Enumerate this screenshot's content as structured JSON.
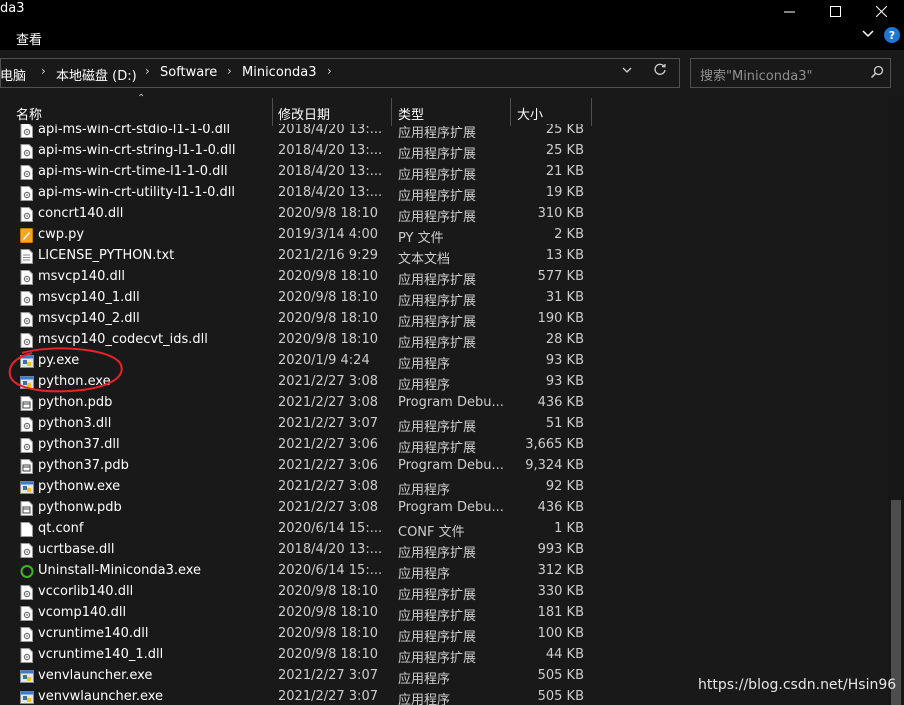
{
  "window": {
    "title": "da3",
    "minimize": "—",
    "maximize": "☐",
    "close": "✕"
  },
  "ribbon": {
    "tab_view": "查看",
    "expand": "⌄",
    "help": "?"
  },
  "address": {
    "crumbs": [
      "电脑",
      "本地磁盘 (D:)",
      "Software",
      "Miniconda3"
    ],
    "separator": "›"
  },
  "search": {
    "placeholder": "搜索\"Miniconda3\""
  },
  "columns": {
    "name": "名称",
    "date": "修改日期",
    "type": "类型",
    "size": "大小"
  },
  "files": [
    {
      "name": "api-ms-win-crt-stdio-l1-1-0.dll",
      "date": "2018/4/20 13:...",
      "type": "应用程序扩展",
      "size": "25 KB",
      "icon": "dll-icon"
    },
    {
      "name": "api-ms-win-crt-string-l1-1-0.dll",
      "date": "2018/4/20 13:...",
      "type": "应用程序扩展",
      "size": "25 KB",
      "icon": "dll-icon"
    },
    {
      "name": "api-ms-win-crt-time-l1-1-0.dll",
      "date": "2018/4/20 13:...",
      "type": "应用程序扩展",
      "size": "21 KB",
      "icon": "dll-icon"
    },
    {
      "name": "api-ms-win-crt-utility-l1-1-0.dll",
      "date": "2018/4/20 13:...",
      "type": "应用程序扩展",
      "size": "19 KB",
      "icon": "dll-icon"
    },
    {
      "name": "concrt140.dll",
      "date": "2020/9/8 18:10",
      "type": "应用程序扩展",
      "size": "310 KB",
      "icon": "dll-icon"
    },
    {
      "name": "cwp.py",
      "date": "2019/3/14 4:00",
      "type": "PY 文件",
      "size": "2 KB",
      "icon": "py-file-icon"
    },
    {
      "name": "LICENSE_PYTHON.txt",
      "date": "2021/2/16 9:29",
      "type": "文本文档",
      "size": "13 KB",
      "icon": "text-file-icon"
    },
    {
      "name": "msvcp140.dll",
      "date": "2020/9/8 18:10",
      "type": "应用程序扩展",
      "size": "577 KB",
      "icon": "dll-icon"
    },
    {
      "name": "msvcp140_1.dll",
      "date": "2020/9/8 18:10",
      "type": "应用程序扩展",
      "size": "31 KB",
      "icon": "dll-icon"
    },
    {
      "name": "msvcp140_2.dll",
      "date": "2020/9/8 18:10",
      "type": "应用程序扩展",
      "size": "190 KB",
      "icon": "dll-icon"
    },
    {
      "name": "msvcp140_codecvt_ids.dll",
      "date": "2020/9/8 18:10",
      "type": "应用程序扩展",
      "size": "28 KB",
      "icon": "dll-icon"
    },
    {
      "name": "py.exe",
      "date": "2020/1/9 4:24",
      "type": "应用程序",
      "size": "93 KB",
      "icon": "python-exe-icon"
    },
    {
      "name": "python.exe",
      "date": "2021/2/27 3:08",
      "type": "应用程序",
      "size": "93 KB",
      "icon": "python-exe-icon"
    },
    {
      "name": "python.pdb",
      "date": "2021/2/27 3:08",
      "type": "Program Debu...",
      "size": "436 KB",
      "icon": "pdb-icon"
    },
    {
      "name": "python3.dll",
      "date": "2021/2/27 3:07",
      "type": "应用程序扩展",
      "size": "51 KB",
      "icon": "dll-icon"
    },
    {
      "name": "python37.dll",
      "date": "2021/2/27 3:06",
      "type": "应用程序扩展",
      "size": "3,665 KB",
      "icon": "dll-icon"
    },
    {
      "name": "python37.pdb",
      "date": "2021/2/27 3:06",
      "type": "Program Debu...",
      "size": "9,324 KB",
      "icon": "pdb-icon"
    },
    {
      "name": "pythonw.exe",
      "date": "2021/2/27 3:08",
      "type": "应用程序",
      "size": "92 KB",
      "icon": "python-exe-icon"
    },
    {
      "name": "pythonw.pdb",
      "date": "2021/2/27 3:08",
      "type": "Program Debu...",
      "size": "436 KB",
      "icon": "pdb-icon"
    },
    {
      "name": "qt.conf",
      "date": "2020/6/14 15:...",
      "type": "CONF 文件",
      "size": "1 KB",
      "icon": "blank-file-icon"
    },
    {
      "name": "ucrtbase.dll",
      "date": "2018/4/20 13:...",
      "type": "应用程序扩展",
      "size": "993 KB",
      "icon": "dll-icon"
    },
    {
      "name": "Uninstall-Miniconda3.exe",
      "date": "2020/6/14 15:...",
      "type": "应用程序",
      "size": "312 KB",
      "icon": "uninstall-icon"
    },
    {
      "name": "vccorlib140.dll",
      "date": "2020/9/8 18:10",
      "type": "应用程序扩展",
      "size": "330 KB",
      "icon": "dll-icon"
    },
    {
      "name": "vcomp140.dll",
      "date": "2020/9/8 18:10",
      "type": "应用程序扩展",
      "size": "181 KB",
      "icon": "dll-icon"
    },
    {
      "name": "vcruntime140.dll",
      "date": "2020/9/8 18:10",
      "type": "应用程序扩展",
      "size": "100 KB",
      "icon": "dll-icon"
    },
    {
      "name": "vcruntime140_1.dll",
      "date": "2020/9/8 18:10",
      "type": "应用程序扩展",
      "size": "44 KB",
      "icon": "dll-icon"
    },
    {
      "name": "venvlauncher.exe",
      "date": "2021/2/27 3:07",
      "type": "应用程序",
      "size": "505 KB",
      "icon": "python-exe-icon"
    },
    {
      "name": "venvwlauncher.exe",
      "date": "2021/2/27 3:07",
      "type": "应用程序",
      "size": "505 KB",
      "icon": "python-exe-icon"
    }
  ],
  "watermark": "https://blog.csdn.net/Hsin96",
  "colors": {
    "annotation": "#e8232a",
    "background": "#191919",
    "scroll_thumb": "#4d4d4d"
  }
}
